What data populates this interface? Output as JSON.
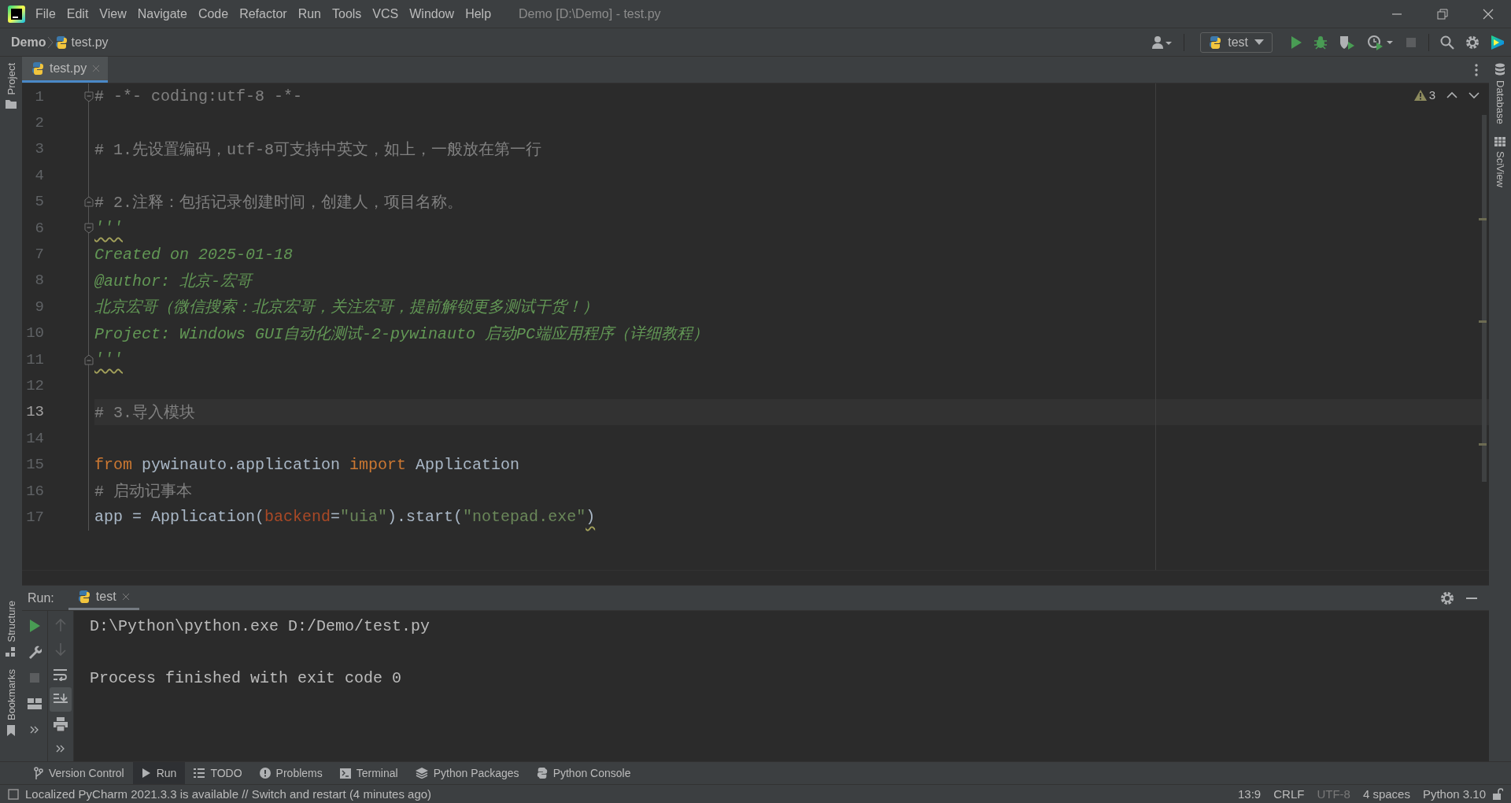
{
  "title_bar": {
    "menu": [
      "File",
      "Edit",
      "View",
      "Navigate",
      "Code",
      "Refactor",
      "Run",
      "Tools",
      "VCS",
      "Window",
      "Help"
    ],
    "window_title": "Demo [D:\\Demo] - test.py"
  },
  "breadcrumbs": {
    "project": "Demo",
    "file": "test.py"
  },
  "run_config": {
    "label": "test"
  },
  "nav_actions": [
    {
      "kind": "run",
      "disabled": false
    },
    {
      "kind": "debug",
      "disabled": false
    },
    {
      "kind": "coverage",
      "disabled": false
    },
    {
      "kind": "profile",
      "disabled": false
    },
    {
      "kind": "stop",
      "disabled": true
    }
  ],
  "left_strip": {
    "top": [
      {
        "kind": "folder",
        "label": "Project"
      }
    ],
    "bottom": [
      {
        "kind": "structure",
        "label": "Structure"
      },
      {
        "kind": "bookmark",
        "label": "Bookmarks"
      }
    ]
  },
  "right_strip": [
    {
      "kind": "database",
      "label": "Database"
    },
    {
      "kind": "grid",
      "label": "SciView"
    }
  ],
  "editor_tabs": [
    {
      "label": "test.py",
      "selected": true
    }
  ],
  "inspection": {
    "count": "3"
  },
  "code_lines": [
    {
      "number": "1",
      "current": false,
      "fold_start": true,
      "fold_end": false,
      "tokens": [
        {
          "kind": "comment",
          "text": "# -*- coding:utf-8 -*-",
          "warning": false
        }
      ]
    },
    {
      "number": "2",
      "current": false,
      "fold_start": false,
      "fold_end": false
    },
    {
      "number": "3",
      "current": false,
      "fold_start": false,
      "fold_end": false,
      "tokens": [
        {
          "kind": "comment",
          "text": "# 1.先设置编码，utf-8可支持中英文，如上，一般放在第一行",
          "warning": false
        }
      ]
    },
    {
      "number": "4",
      "current": false,
      "fold_start": false,
      "fold_end": false
    },
    {
      "number": "5",
      "current": false,
      "fold_start": false,
      "fold_end": true,
      "tokens": [
        {
          "kind": "comment",
          "text": "# 2.注释：包括记录创建时间，创建人，项目名称。",
          "warning": false
        }
      ]
    },
    {
      "number": "6",
      "current": false,
      "fold_start": true,
      "fold_end": false,
      "tokens": [
        {
          "kind": "doc",
          "text": "'''",
          "warning": true
        }
      ]
    },
    {
      "number": "7",
      "current": false,
      "fold_start": false,
      "fold_end": false,
      "tokens": [
        {
          "kind": "doc",
          "text": "Created on 2025-01-18",
          "warning": false
        }
      ]
    },
    {
      "number": "8",
      "current": false,
      "fold_start": false,
      "fold_end": false,
      "tokens": [
        {
          "kind": "doc",
          "text": "@author: 北京-宏哥",
          "warning": false
        }
      ]
    },
    {
      "number": "9",
      "current": false,
      "fold_start": false,
      "fold_end": false,
      "tokens": [
        {
          "kind": "doc",
          "text": "北京宏哥（微信搜索：北京宏哥，关注宏哥，提前解锁更多测试干货！）",
          "warning": false
        }
      ]
    },
    {
      "number": "10",
      "current": false,
      "fold_start": false,
      "fold_end": false,
      "tokens": [
        {
          "kind": "doc",
          "text": "Project: Windows GUI自动化测试-2-pywinauto 启动PC端应用程序（详细教程）",
          "warning": false
        }
      ]
    },
    {
      "number": "11",
      "current": false,
      "fold_start": false,
      "fold_end": true,
      "tokens": [
        {
          "kind": "doc",
          "text": "'''",
          "warning": true
        }
      ]
    },
    {
      "number": "12",
      "current": false,
      "fold_start": false,
      "fold_end": false
    },
    {
      "number": "13",
      "current": true,
      "fold_start": false,
      "fold_end": false,
      "tokens": [
        {
          "kind": "comment",
          "text": "# 3.导入模块",
          "warning": false
        }
      ]
    },
    {
      "number": "14",
      "current": false,
      "fold_start": false,
      "fold_end": false
    },
    {
      "number": "15",
      "current": false,
      "fold_start": false,
      "fold_end": false,
      "tokens": [
        {
          "kind": "keyword",
          "text": "from",
          "warning": false
        },
        {
          "kind": "plain",
          "text": " pywinauto.application ",
          "warning": false
        },
        {
          "kind": "keyword",
          "text": "import",
          "warning": false
        },
        {
          "kind": "plain",
          "text": " Application",
          "warning": false
        }
      ]
    },
    {
      "number": "16",
      "current": false,
      "fold_start": false,
      "fold_end": false,
      "tokens": [
        {
          "kind": "comment",
          "text": "# 启动记事本",
          "warning": false
        }
      ]
    },
    {
      "number": "17",
      "current": false,
      "fold_start": false,
      "fold_end": false,
      "tokens": [
        {
          "kind": "plain",
          "text": "app = Application(",
          "warning": false
        },
        {
          "kind": "param",
          "text": "backend",
          "warning": false
        },
        {
          "kind": "plain",
          "text": "=",
          "warning": false
        },
        {
          "kind": "string",
          "text": "\"uia\"",
          "warning": false
        },
        {
          "kind": "plain",
          "text": ").start(",
          "warning": false
        },
        {
          "kind": "string",
          "text": "\"notepad.exe\"",
          "warning": false
        },
        {
          "kind": "plain",
          "text": ")",
          "warning": true
        }
      ]
    }
  ],
  "run_panel": {
    "label": "Run:",
    "tabs": [
      {
        "label": "test",
        "selected": true
      }
    ],
    "tools_left": [
      {
        "kind": "rerun",
        "disabled": false,
        "active": false
      },
      {
        "kind": "wrench",
        "disabled": false,
        "active": false
      },
      {
        "kind": "stop",
        "disabled": true,
        "active": false
      },
      {
        "kind": "layout",
        "disabled": false,
        "active": false
      },
      {
        "kind": "more",
        "disabled": false,
        "active": false
      }
    ],
    "tools_right": [
      {
        "kind": "up",
        "disabled": true,
        "active": false
      },
      {
        "kind": "down",
        "disabled": true,
        "active": false
      },
      {
        "kind": "wrap",
        "disabled": false,
        "active": false
      },
      {
        "kind": "scroll-end",
        "disabled": false,
        "active": true
      },
      {
        "kind": "print",
        "disabled": false,
        "active": false
      },
      {
        "kind": "more",
        "disabled": false,
        "active": false
      }
    ],
    "output": [
      {
        "text": "D:\\Python\\python.exe D:/Demo/test.py"
      },
      {
        "text": "Process finished with exit code 0"
      }
    ]
  },
  "tool_windows": [
    {
      "kind": "branch",
      "label": "Version Control",
      "selected": false
    },
    {
      "kind": "run",
      "label": "Run",
      "selected": true
    },
    {
      "kind": "list",
      "label": "TODO",
      "selected": false
    },
    {
      "kind": "problems",
      "label": "Problems",
      "selected": false
    },
    {
      "kind": "terminal",
      "label": "Terminal",
      "selected": false
    },
    {
      "kind": "layers",
      "label": "Python Packages",
      "selected": false
    },
    {
      "kind": "python",
      "label": "Python Console",
      "selected": false
    }
  ],
  "status_bar": {
    "message": "Localized PyCharm 2021.3.3 is available // Switch and restart (4 minutes ago)",
    "items": [
      {
        "text": "13:9",
        "dim": false
      },
      {
        "text": "CRLF",
        "dim": false
      },
      {
        "text": "UTF-8",
        "dim": true
      },
      {
        "text": "4 spaces",
        "dim": false
      },
      {
        "text": "Python 3.10",
        "dim": false
      }
    ]
  }
}
